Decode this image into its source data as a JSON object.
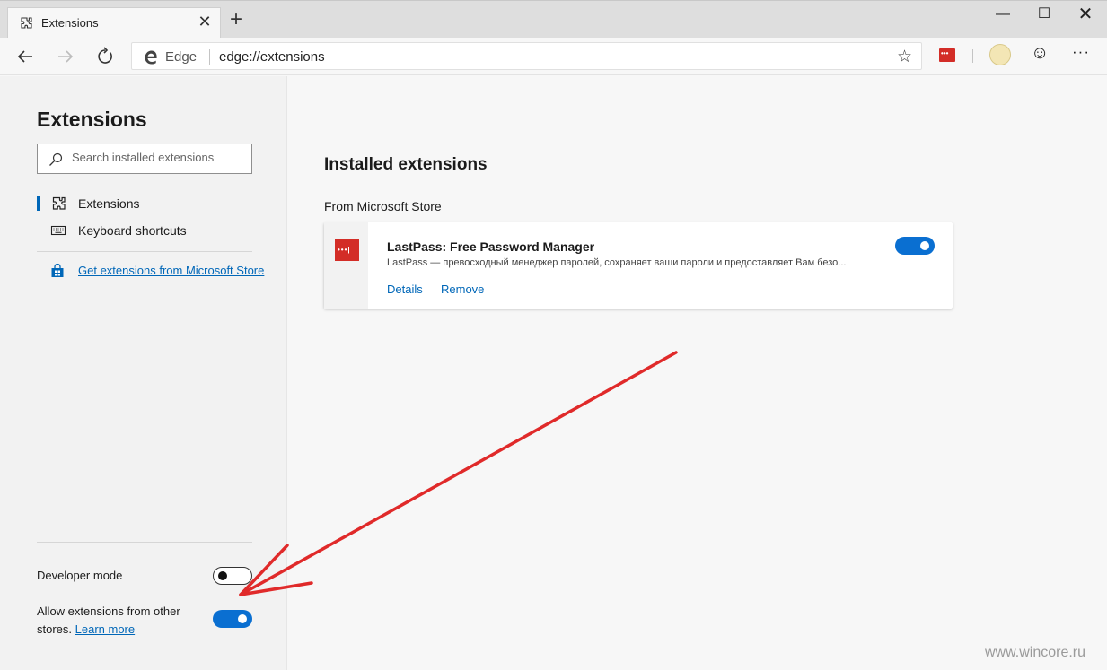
{
  "tab": {
    "title": "Extensions",
    "close": "✕"
  },
  "new_tab": "+",
  "window": {
    "minimize": "—",
    "maximize": "☐",
    "close": "✕"
  },
  "toolbar": {
    "back": "←",
    "forward": "→",
    "refresh": "↻",
    "address_label": "Edge",
    "url": "edge://extensions",
    "favorite": "☆",
    "smiley": "☺",
    "more": "···"
  },
  "sidebar": {
    "title": "Extensions",
    "search_placeholder": "Search installed extensions",
    "items": [
      {
        "label": "Extensions",
        "icon": "puzzle-icon",
        "active": true
      },
      {
        "label": "Keyboard shortcuts",
        "icon": "keyboard-icon",
        "active": false
      }
    ],
    "store_link": "Get extensions from Microsoft Store",
    "developer_mode_label": "Developer mode",
    "developer_mode_on": false,
    "allow_other_text": "Allow extensions from other stores.",
    "learn_more": "Learn more",
    "allow_other_on": true
  },
  "main": {
    "title": "Installed extensions",
    "section": "From Microsoft Store",
    "extensions": [
      {
        "name": "LastPass: Free Password Manager",
        "description": "LastPass — превосходный менеджер паролей, сохраняет ваши пароли и предоставляет Вам безо...",
        "details": "Details",
        "remove": "Remove",
        "enabled": true,
        "icon": "lastpass-icon",
        "icon_color": "#d32d27"
      }
    ]
  },
  "colors": {
    "accent": "#0067b8",
    "toggle_on": "#0a6fd1",
    "annotation_arrow": "#e02a2a"
  },
  "watermark": "www.wincore.ru"
}
